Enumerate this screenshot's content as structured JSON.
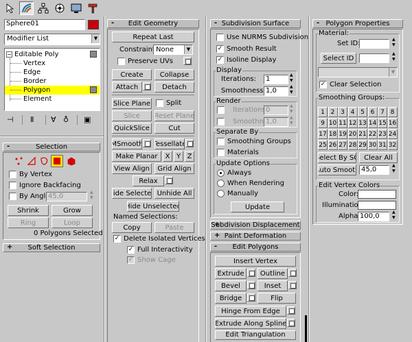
{
  "object_name": "Sphere01",
  "object_color": "#c5000b",
  "modifier_list": "Modifier List",
  "stack": {
    "root": "Editable Poly",
    "subs": [
      "Vertex",
      "Edge",
      "Border",
      "Polygon",
      "Element"
    ],
    "selected": "Polygon"
  },
  "selection": {
    "title": "Selection",
    "by_vertex": "By Vertex",
    "ignore_backfacing": "Ignore Backfacing",
    "by_angle": "By Angle:",
    "angle_value": "45,0",
    "shrink": "Shrink",
    "grow": "Grow",
    "ring": "Ring",
    "loop": "Loop",
    "status": "0 Polygons Selected"
  },
  "soft_selection": "Soft Selection",
  "edit_geometry": {
    "title": "Edit Geometry",
    "repeat_last": "Repeat Last",
    "constraints": "Constraints:",
    "constraints_value": "None",
    "preserve_uvs": "Preserve UVs",
    "create": "Create",
    "collapse": "Collapse",
    "attach": "Attach",
    "detach": "Detach",
    "slice_plane": "Slice Plane",
    "split": "Split",
    "slice": "Slice",
    "reset_plane": "Reset Plane",
    "quickslice": "QuickSlice",
    "cut": "Cut",
    "msmooth": "MSmooth",
    "tessellate": "Tessellate",
    "make_planar": "Make Planar",
    "x": "X",
    "y": "Y",
    "z": "Z",
    "view_align": "View Align",
    "grid_align": "Grid Align",
    "relax": "Relax",
    "hide_selected": "Hide Selected",
    "unhide_all": "Unhide All",
    "hide_unselected": "Hide Unselected",
    "named_selections": "Named Selections:",
    "copy": "Copy",
    "paste": "Paste",
    "delete_isolated": "Delete Isolated Vertices",
    "full_interactivity": "Full Interactivity",
    "show_cage": "Show Cage"
  },
  "subdivision_surface": {
    "title": "Subdivision Surface",
    "use_nurms": "Use NURMS Subdivision",
    "smooth_result": "Smooth Result",
    "isoline_display": "Isoline Display",
    "display": "Display",
    "iterations": "Iterations:",
    "iterations_value": "1",
    "smoothness": "Smoothness:",
    "smoothness_value": "1,0",
    "render": "Render",
    "render_iterations": "Iterations:",
    "render_iterations_value": "0",
    "render_smoothness": "Smoothness:",
    "render_smoothness_value": "1,0",
    "separate_by": "Separate By",
    "smoothing_groups": "Smoothing Groups",
    "materials": "Materials",
    "update_options": "Update Options",
    "always": "Always",
    "when_rendering": "When Rendering",
    "manually": "Manually",
    "update": "Update"
  },
  "subdivision_displacement": "Subdivision Displacement",
  "paint_deformation": "Paint Deformation",
  "edit_polygons": {
    "title": "Edit Polygons",
    "insert_vertex": "Insert Vertex",
    "extrude": "Extrude",
    "outline": "Outline",
    "bevel": "Bevel",
    "inset": "Inset",
    "bridge": "Bridge",
    "flip": "Flip",
    "hinge_from_edge": "Hinge From Edge",
    "extrude_along_spline": "Extrude Along Spline",
    "edit_triangulation": "Edit Triangulation"
  },
  "polygon_properties": {
    "title": "Polygon Properties",
    "material": "Material:",
    "set_id": "Set ID:",
    "select_id": "Select ID",
    "clear_selection": "Clear Selection",
    "smoothing_groups": "Smoothing Groups:",
    "groups": [
      "1",
      "2",
      "3",
      "4",
      "5",
      "6",
      "7",
      "8",
      "9",
      "10",
      "11",
      "12",
      "13",
      "14",
      "15",
      "16",
      "17",
      "18",
      "19",
      "20",
      "21",
      "22",
      "23",
      "24",
      "25",
      "26",
      "27",
      "28",
      "29",
      "30",
      "31",
      "32"
    ],
    "select_by_sg": "Select By SG",
    "clear_all": "Clear All",
    "auto_smooth": "Auto Smooth",
    "auto_smooth_value": "45,0",
    "edit_vertex_colors": "Edit Vertex Colors",
    "color": "Color:",
    "illumination": "Illumination:",
    "alpha": "Alpha:",
    "alpha_value": "100,0"
  }
}
